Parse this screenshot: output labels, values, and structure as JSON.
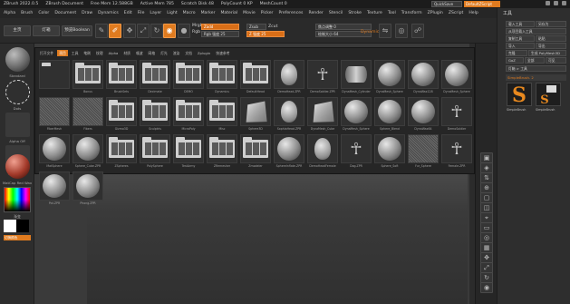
{
  "titlebar": {
    "items": [
      "ZBrush 2022.0.5",
      "ZBrush Document",
      "Free Mem 12.588GB",
      "Active Mem 785",
      "Scratch Disk 48",
      "PolyCount 0 KP",
      "MeshCount 0"
    ],
    "quicksave": "QuickSave",
    "default_script": "DefaultZScript",
    "orange_item": "0"
  },
  "menubar": {
    "items": [
      "Alpha",
      "Brush",
      "Color",
      "Document",
      "Draw",
      "Dynamics",
      "Edit",
      "File",
      "Layer",
      "Light",
      "Macro",
      "Marker",
      "Material",
      "Movie",
      "Picker",
      "Preferences",
      "Render",
      "Stencil",
      "Stroke",
      "Texture",
      "Tool",
      "Transform",
      "ZPlugin",
      "ZScript",
      "Help"
    ]
  },
  "shelf": {
    "home_label": "主页",
    "lightbox_label": "灯箱",
    "preview_label": "预览Boolean",
    "edit_label": "Edit",
    "draw_label": "Draw",
    "move_label": "Move",
    "scale_label": "Scale",
    "rotate_label": "Rotate",
    "mrgb_label": "Mrgb",
    "rgb_label": "Rgb",
    "m_label": "M",
    "zadd_label": "Zadd",
    "zsub_label": "Zsub",
    "zcut_label": "Zcut",
    "rgb_intensity": "Rgb 强度 25",
    "z_intensity": "Z 强度 25",
    "focal_shift": "焦点调整 0",
    "draw_size": "绘制大小 64",
    "dynamic_label": "Dynamic"
  },
  "leftshelf": {
    "items": [
      {
        "caption": "Standard",
        "color": "#6a6a6a"
      },
      {
        "caption": "Dots",
        "color": "#2f2f2f"
      },
      {
        "caption": "Alpha Off",
        "color": "#3a3a3a"
      },
      {
        "caption": "Texture Off",
        "color": "#3a3a3a"
      },
      {
        "caption": "MatCap Red Wax",
        "color": "#a33a2a"
      }
    ],
    "gradient_label": "渐变",
    "switch_label": "切换颜色"
  },
  "popup": {
    "tabs": [
      "打开文件",
      "项目",
      "工具",
      "笔刷",
      "纹理",
      "Alpha",
      "材质",
      "噪波",
      "网格",
      "灯光",
      "渲染",
      "文档",
      "Zplugin",
      "快速参考"
    ],
    "active_tab": 1,
    "cells": [
      {
        "kind": "folder-empty",
        "caption": ""
      },
      {
        "kind": "folder",
        "caption": "Bonus"
      },
      {
        "kind": "folder",
        "caption": "BrushSets"
      },
      {
        "kind": "folder",
        "caption": "Decimate"
      },
      {
        "kind": "folder",
        "caption": "DEMO"
      },
      {
        "kind": "folder",
        "caption": "Dynamics"
      },
      {
        "kind": "folder",
        "caption": "DefaultHead"
      },
      {
        "kind": "head",
        "caption": "DemoHead.ZPR"
      },
      {
        "kind": "fig",
        "caption": "DemoSoldier.ZPR"
      },
      {
        "kind": "cyl",
        "caption": "DynaMesh_Cylinder"
      },
      {
        "kind": "sphere",
        "caption": "DynaMesh_Sphere"
      },
      {
        "kind": "sphere",
        "caption": "DynaWax128"
      },
      {
        "kind": "sphere",
        "caption": "DynaMesh_Sphere"
      },
      {
        "kind": "tex",
        "caption": "FiberMesh"
      },
      {
        "kind": "tex",
        "caption": "Fibers"
      },
      {
        "kind": "folder",
        "caption": "Gizmo3D"
      },
      {
        "kind": "folder",
        "caption": "Sculptris"
      },
      {
        "kind": "folder",
        "caption": "MicroPoly"
      },
      {
        "kind": "folder",
        "caption": "Misc"
      },
      {
        "kind": "box",
        "caption": "Sphere3D"
      },
      {
        "kind": "head",
        "caption": "SophiaHead.ZPR"
      },
      {
        "kind": "box",
        "caption": "DynaMesh_Cube"
      },
      {
        "kind": "sphere",
        "caption": "DynaMesh_Sphere"
      },
      {
        "kind": "sphere",
        "caption": "Sphere_Blend"
      },
      {
        "kind": "sphere",
        "caption": "DynaWax64"
      },
      {
        "kind": "fig",
        "caption": "DemoSoldier"
      },
      {
        "kind": "sphere",
        "caption": "MatSphere"
      },
      {
        "kind": "sphere",
        "caption": "Sphere_Cube.ZPR"
      },
      {
        "kind": "folder",
        "caption": "ZSpheres"
      },
      {
        "kind": "folder",
        "caption": "PolySphere"
      },
      {
        "kind": "folder",
        "caption": "TestArmy"
      },
      {
        "kind": "folder",
        "caption": "ZRemesher"
      },
      {
        "kind": "folder",
        "caption": "Zmodeler"
      },
      {
        "kind": "sphere",
        "caption": "SphereInflate.ZPR"
      },
      {
        "kind": "head",
        "caption": "DemoHeadFemale"
      },
      {
        "kind": "fig",
        "caption": "Dog.ZPR"
      },
      {
        "kind": "sphere",
        "caption": "Sphere_Soft"
      },
      {
        "kind": "tex",
        "caption": "Fur_Sphere"
      },
      {
        "kind": "fig",
        "caption": "Female.ZPR"
      },
      {
        "kind": "sphere",
        "caption": "Pot.ZPR"
      },
      {
        "kind": "sphere",
        "caption": "Phong.ZPR"
      }
    ]
  },
  "rightpanel": {
    "title": "工具",
    "load_tool": "载入工具",
    "save_as": "另存为",
    "load_project": "从项目载入工具",
    "copy_tool": "复制工具",
    "paste_tool": "粘贴",
    "import": "导入",
    "export": "导出",
    "clone": "克隆",
    "make_polymesh": "生成 PolyMesh3D",
    "goz": "GoZ",
    "all": "全部",
    "visible": "可见",
    "lightbox_tools": "灯箱 > 工具",
    "current_tool": "SimpleBrush. 2",
    "tool1_caption": "SimpleBrush",
    "tool2_caption": "SimpleBrush"
  },
  "rightdock": {
    "labels": [
      "BPR",
      "SPix 3",
      "Scroll",
      "Zoom",
      "Actual",
      "AAHalf",
      "Persp",
      "Floor",
      "Local",
      "Frame",
      "Move",
      "Scale",
      "Rotate",
      "Solo",
      "Transp"
    ]
  },
  "colors": {
    "accent": "#e07b1f",
    "bg": "#2b2b2b"
  }
}
